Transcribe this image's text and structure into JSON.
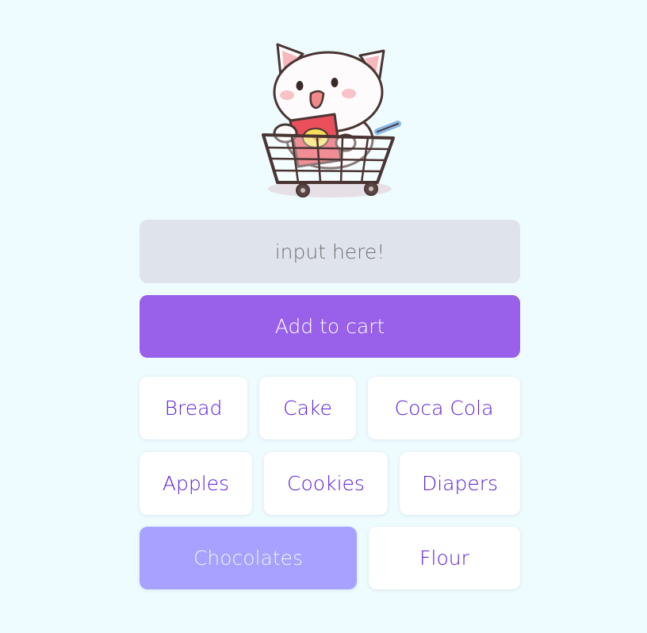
{
  "mascot": {
    "icon": "cat-in-shopping-cart-icon"
  },
  "search": {
    "placeholder": "input here!",
    "value": ""
  },
  "add_button": {
    "label": "Add to cart"
  },
  "items": [
    {
      "label": "Bread",
      "selected": false
    },
    {
      "label": "Cake",
      "selected": false
    },
    {
      "label": "Coca Cola",
      "selected": false
    },
    {
      "label": "Apples",
      "selected": false
    },
    {
      "label": "Cookies",
      "selected": false
    },
    {
      "label": "Diapers",
      "selected": false
    },
    {
      "label": "Chocolates",
      "selected": true
    },
    {
      "label": "Flour",
      "selected": false
    }
  ],
  "colors": {
    "background": "#eefcff",
    "accent": "#9960ea",
    "item_text": "#5a1bd8",
    "selected_item": "#a7a1ff",
    "input_bg": "#dfe3ec"
  }
}
